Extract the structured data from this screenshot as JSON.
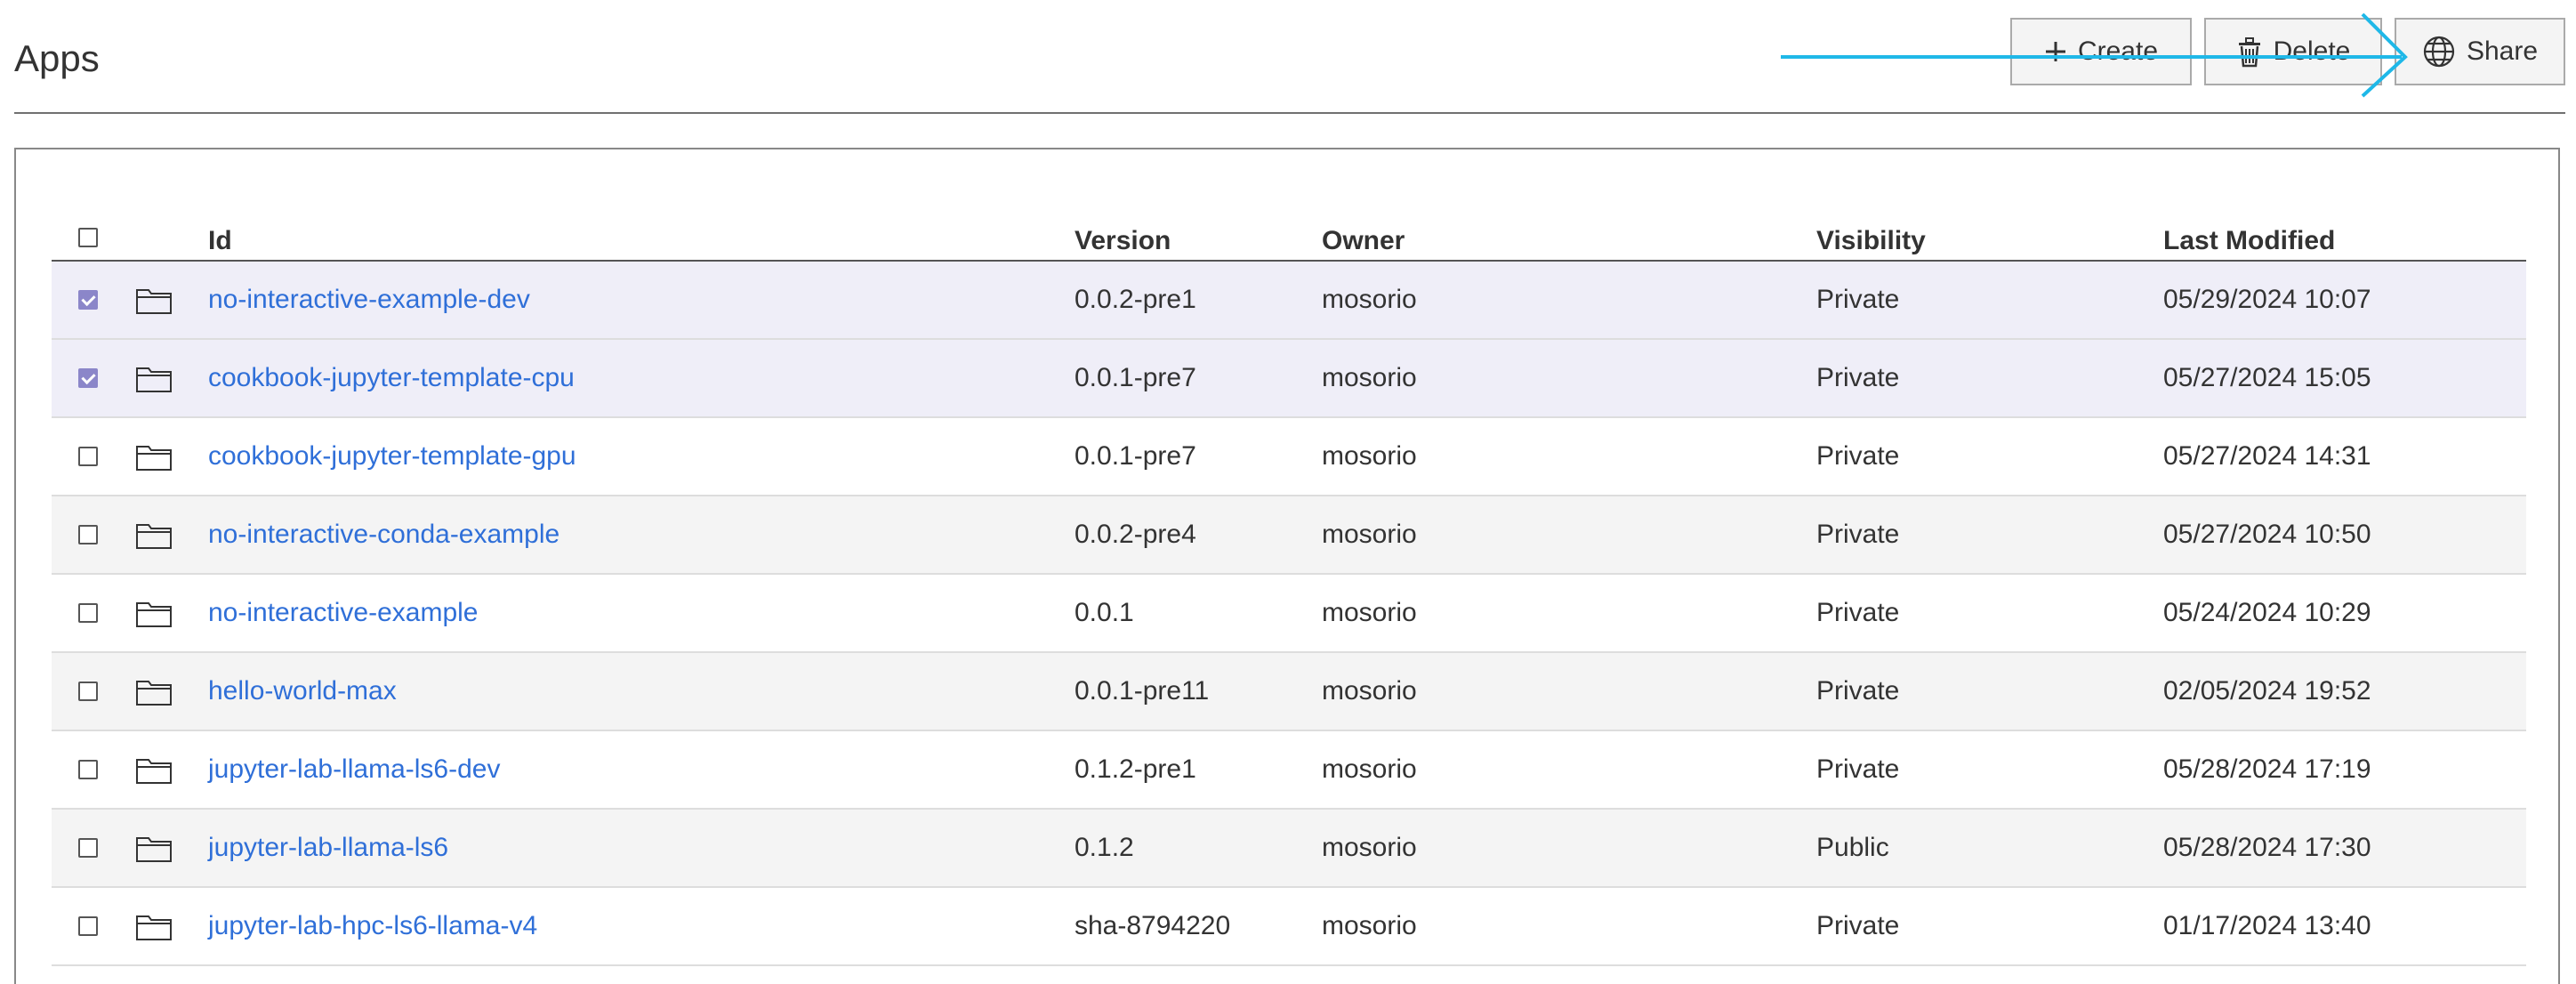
{
  "header": {
    "title": "Apps"
  },
  "toolbar": {
    "create_label": "Create",
    "delete_label": "Delete",
    "share_label": "Share"
  },
  "annotation": {
    "arrow_color": "#1fb8e8"
  },
  "table": {
    "columns": {
      "id": "Id",
      "version": "Version",
      "owner": "Owner",
      "visibility": "Visibility",
      "last_modified": "Last Modified"
    },
    "rows": [
      {
        "id": "no-interactive-example-dev",
        "version": "0.0.2-pre1",
        "owner": "mosorio",
        "visibility": "Private",
        "last_modified": "05/29/2024 10:07",
        "checked": true
      },
      {
        "id": "cookbook-jupyter-template-cpu",
        "version": "0.0.1-pre7",
        "owner": "mosorio",
        "visibility": "Private",
        "last_modified": "05/27/2024 15:05",
        "checked": true
      },
      {
        "id": "cookbook-jupyter-template-gpu",
        "version": "0.0.1-pre7",
        "owner": "mosorio",
        "visibility": "Private",
        "last_modified": "05/27/2024 14:31",
        "checked": false
      },
      {
        "id": "no-interactive-conda-example",
        "version": "0.0.2-pre4",
        "owner": "mosorio",
        "visibility": "Private",
        "last_modified": "05/27/2024 10:50",
        "checked": false
      },
      {
        "id": "no-interactive-example",
        "version": "0.0.1",
        "owner": "mosorio",
        "visibility": "Private",
        "last_modified": "05/24/2024 10:29",
        "checked": false
      },
      {
        "id": "hello-world-max",
        "version": "0.0.1-pre11",
        "owner": "mosorio",
        "visibility": "Private",
        "last_modified": "02/05/2024 19:52",
        "checked": false
      },
      {
        "id": "jupyter-lab-llama-ls6-dev",
        "version": "0.1.2-pre1",
        "owner": "mosorio",
        "visibility": "Private",
        "last_modified": "05/28/2024 17:19",
        "checked": false
      },
      {
        "id": "jupyter-lab-llama-ls6",
        "version": "0.1.2",
        "owner": "mosorio",
        "visibility": "Public",
        "last_modified": "05/28/2024 17:30",
        "checked": false
      },
      {
        "id": "jupyter-lab-hpc-ls6-llama-v4",
        "version": "sha-8794220",
        "owner": "mosorio",
        "visibility": "Private",
        "last_modified": "01/17/2024 13:40",
        "checked": false
      }
    ]
  }
}
